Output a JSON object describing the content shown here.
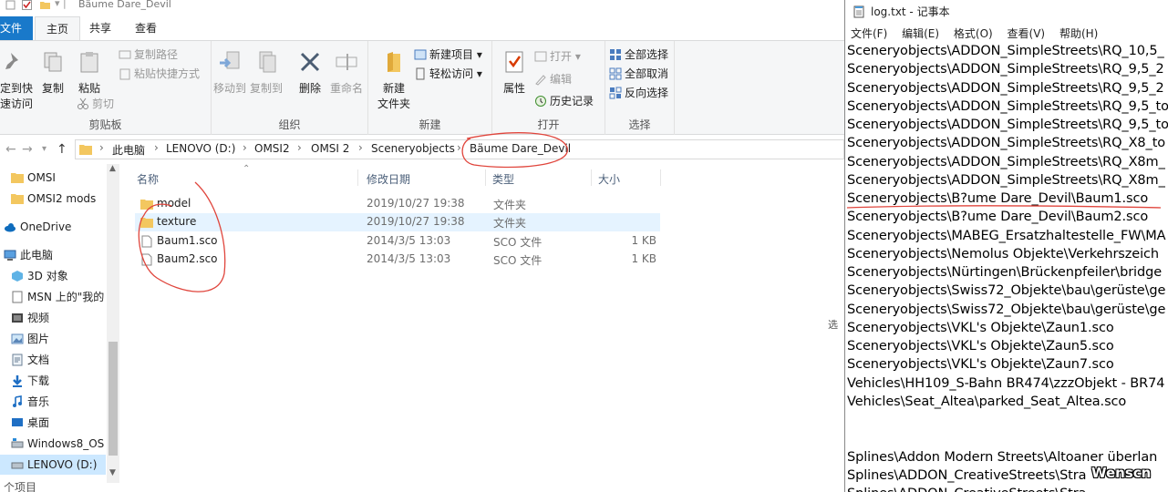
{
  "explorer": {
    "window_title": "Bäume Dare_Devil",
    "tabs": [
      "文件",
      "主页",
      "共享",
      "查看"
    ],
    "ribbon": {
      "clipboard": {
        "label": "剪贴板",
        "pin_line1": "定到快",
        "pin_line2": "速访问",
        "copy": "复制",
        "paste": "粘贴",
        "copy_path": "复制路径",
        "paste_shortcut": "粘贴快捷方式",
        "cut": "剪切"
      },
      "organize": {
        "label": "组织",
        "move_to": "移动到",
        "copy_to": "复制到",
        "delete": "删除",
        "rename": "重命名"
      },
      "new": {
        "label": "新建",
        "new_folder_line1": "新建",
        "new_folder_line2": "文件夹",
        "new_item": "新建项目",
        "easy_access": "轻松访问"
      },
      "open": {
        "label": "打开",
        "properties": "属性",
        "open": "打开",
        "edit": "编辑",
        "history": "历史记录"
      },
      "select": {
        "label": "选择",
        "select_all": "全部选择",
        "select_none": "全部取消",
        "invert": "反向选择"
      }
    },
    "address": {
      "crumbs": [
        "此电脑",
        "LENOVO (D:)",
        "OMSI2",
        "OMSI 2",
        "Sceneryobjects",
        "Bäume Dare_Devil"
      ]
    },
    "nav": [
      {
        "label": "OMSI",
        "icon": "folder-icon"
      },
      {
        "label": "OMSI2 mods",
        "icon": "folder-icon"
      },
      {
        "label": "OneDrive",
        "icon": "cloud-icon"
      },
      {
        "label": "此电脑",
        "icon": "computer-icon"
      },
      {
        "label": "3D 对象",
        "icon": "cube-icon"
      },
      {
        "label": "MSN 上的\"我的",
        "icon": "document-icon"
      },
      {
        "label": "视频",
        "icon": "video-icon"
      },
      {
        "label": "图片",
        "icon": "picture-icon"
      },
      {
        "label": "文档",
        "icon": "document-icon"
      },
      {
        "label": "下载",
        "icon": "download-icon"
      },
      {
        "label": "音乐",
        "icon": "music-icon"
      },
      {
        "label": "桌面",
        "icon": "desktop-icon"
      },
      {
        "label": "Windows8_OS",
        "icon": "drive-icon"
      },
      {
        "label": "LENOVO (D:)",
        "icon": "drive-icon"
      },
      {
        "label": "个项目",
        "icon": ""
      }
    ],
    "columns": {
      "name": "名称",
      "modified": "修改日期",
      "type": "类型",
      "size": "大小"
    },
    "files": [
      {
        "name": "model",
        "modified": "2019/10/27 19:38",
        "type": "文件夹",
        "size": ""
      },
      {
        "name": "texture",
        "modified": "2019/10/27 19:38",
        "type": "文件夹",
        "size": ""
      },
      {
        "name": "Baum1.sco",
        "modified": "2014/3/5 13:03",
        "type": "SCO 文件",
        "size": "1 KB"
      },
      {
        "name": "Baum2.sco",
        "modified": "2014/3/5 13:03",
        "type": "SCO 文件",
        "size": "1 KB"
      }
    ],
    "side_label": "选"
  },
  "notepad": {
    "title": "log.txt - 记事本",
    "menu": [
      "文件(F)",
      "编辑(E)",
      "格式(O)",
      "查看(V)",
      "帮助(H)"
    ],
    "lines": [
      "Sceneryobjects\\ADDON_SimpleStreets\\RQ_10,5_",
      "Sceneryobjects\\ADDON_SimpleStreets\\RQ_9,5_2",
      "Sceneryobjects\\ADDON_SimpleStreets\\RQ_9,5_2",
      "Sceneryobjects\\ADDON_SimpleStreets\\RQ_9,5_to",
      "Sceneryobjects\\ADDON_SimpleStreets\\RQ_9,5_to",
      "Sceneryobjects\\ADDON_SimpleStreets\\RQ_X8_to",
      "Sceneryobjects\\ADDON_SimpleStreets\\RQ_X8m_",
      "Sceneryobjects\\ADDON_SimpleStreets\\RQ_X8m_",
      "Sceneryobjects\\B?ume Dare_Devil\\Baum1.sco",
      "Sceneryobjects\\B?ume Dare_Devil\\Baum2.sco",
      "Sceneryobjects\\MABEG_Ersatzhaltestelle_FW\\MA",
      "Sceneryobjects\\Nemolus Objekte\\Verkehrszeich",
      "Sceneryobjects\\Nürtingen\\Brückenpfeiler\\bridge",
      "Sceneryobjects\\Swiss72_Objekte\\bau\\gerüste\\ge",
      "Sceneryobjects\\Swiss72_Objekte\\bau\\gerüste\\ge",
      "Sceneryobjects\\VKL's Objekte\\Zaun1.sco",
      "Sceneryobjects\\VKL's Objekte\\Zaun5.sco",
      "Sceneryobjects\\VKL's Objekte\\Zaun7.sco",
      "Vehicles\\HH109_S-Bahn BR474\\zzzObjekt - BR74",
      "Vehicles\\Seat_Altea\\parked_Seat_Altea.sco",
      "",
      "",
      "Splines\\Addon Modern Streets\\Altoaner überlan",
      "Splines\\ADDON_CreativeStreets\\Stra",
      "Splines\\ADDON_CreativeStreets\\Stra"
    ],
    "watermark": "Wenscn"
  }
}
